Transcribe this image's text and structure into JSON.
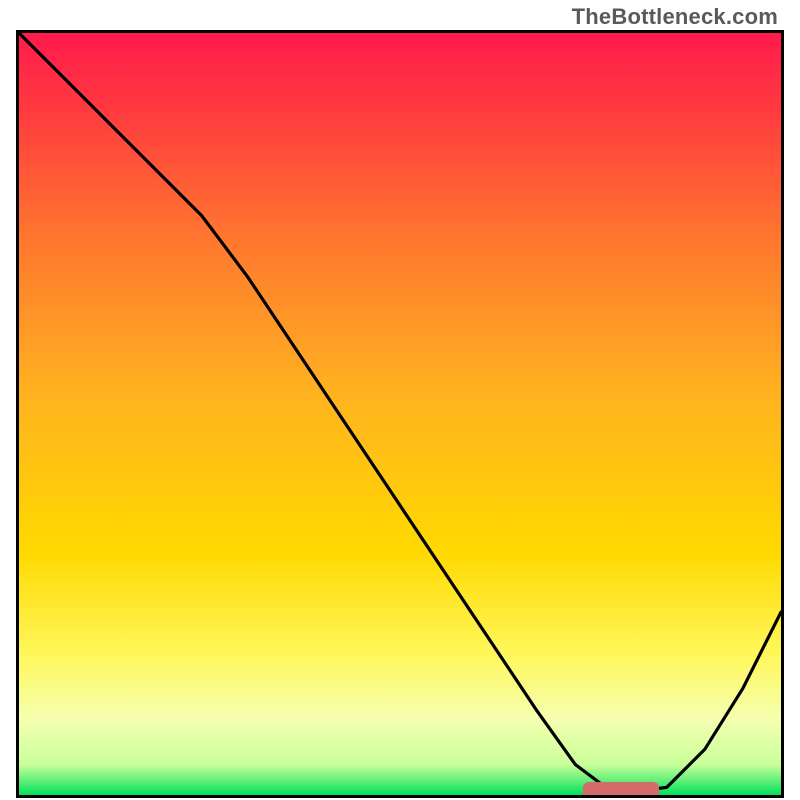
{
  "watermark": "TheBottleneck.com",
  "chart_data": {
    "type": "line",
    "title": "",
    "xlabel": "",
    "ylabel": "",
    "xlim": [
      0,
      100
    ],
    "ylim": [
      0,
      100
    ],
    "grid": false,
    "legend": false,
    "annotations": [],
    "background_gradient": {
      "top": "#ff1a4d",
      "middle": "#ffd900",
      "bottom_band": "#f5ffb0",
      "bottom_stripe": "#00e05a"
    },
    "series": [
      {
        "name": "curve",
        "x": [
          0,
          7,
          16,
          24,
          30,
          40,
          50,
          60,
          68,
          73,
          77,
          81,
          85,
          90,
          95,
          100
        ],
        "y": [
          100,
          93,
          84,
          76,
          68,
          53,
          38,
          23,
          11,
          4,
          1,
          0.5,
          1,
          6,
          14,
          24
        ]
      }
    ],
    "marker": {
      "x_center": 79,
      "y": 0.6,
      "width": 10,
      "height": 2.2,
      "color": "#d46a6a",
      "shape": "rounded-rect"
    }
  }
}
